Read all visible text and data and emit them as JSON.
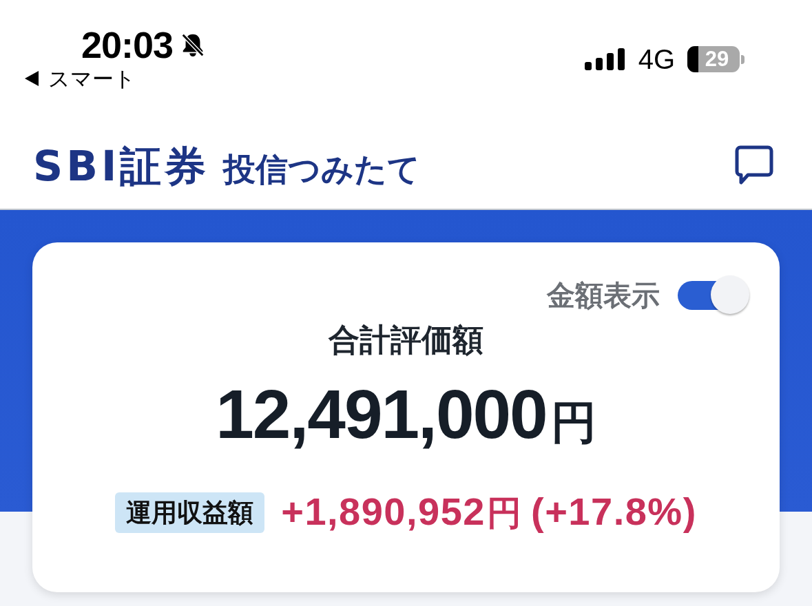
{
  "status_bar": {
    "time": "20:03",
    "back_label": "スマート",
    "network": "4G",
    "battery": "29"
  },
  "header": {
    "brand": "SBI証券",
    "title": "投信つみたて"
  },
  "summary": {
    "amount_toggle": {
      "label": "金額表示",
      "on": true
    },
    "total_label": "合計評価額",
    "total_value": "12,491,000",
    "total_unit": "円",
    "gain_label": "運用収益額",
    "gain_value": "+1,890,952",
    "gain_unit": "円",
    "gain_rate": "(+17.8%)"
  }
}
